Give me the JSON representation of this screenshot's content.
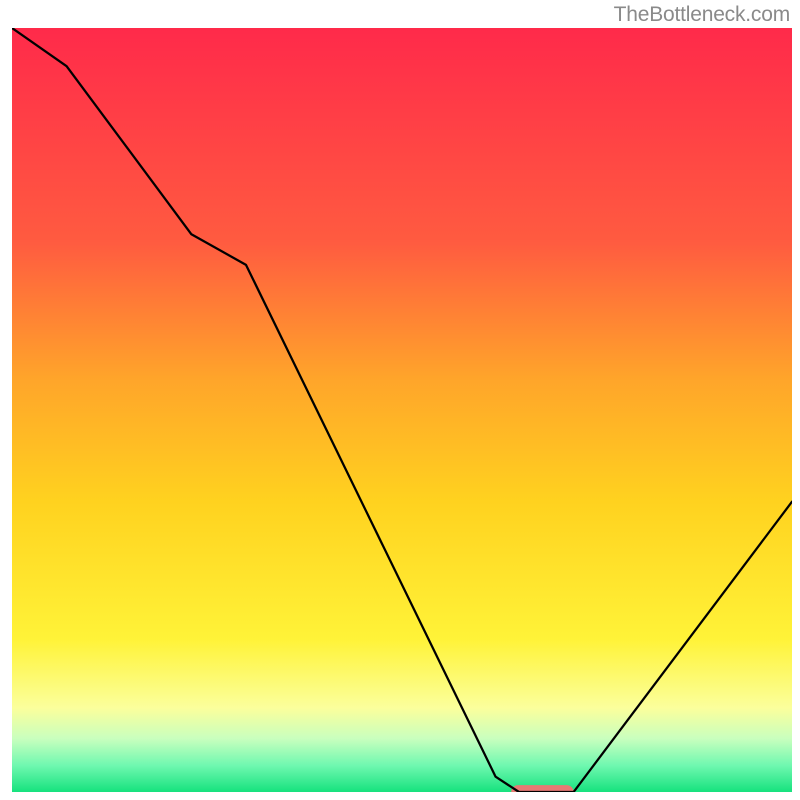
{
  "attribution": "TheBottleneck.com",
  "chart_data": {
    "type": "line",
    "title": "",
    "xlabel": "",
    "ylabel": "",
    "xlim": [
      0,
      100
    ],
    "ylim": [
      0,
      100
    ],
    "background": {
      "type": "linear-gradient",
      "angle_deg": 180,
      "stops": [
        {
          "offset": 0.0,
          "color": "#ff2a4a"
        },
        {
          "offset": 0.28,
          "color": "#ff5b40"
        },
        {
          "offset": 0.46,
          "color": "#ffa52a"
        },
        {
          "offset": 0.62,
          "color": "#ffd21f"
        },
        {
          "offset": 0.8,
          "color": "#fff338"
        },
        {
          "offset": 0.89,
          "color": "#fbff9c"
        },
        {
          "offset": 0.93,
          "color": "#c9ffbe"
        },
        {
          "offset": 0.965,
          "color": "#70f8b0"
        },
        {
          "offset": 1.0,
          "color": "#16e27e"
        }
      ]
    },
    "series": [
      {
        "name": "bottleneck-curve",
        "x": [
          0,
          7,
          23,
          30,
          62,
          65,
          72,
          100
        ],
        "y": [
          100,
          95,
          73,
          69,
          2,
          0,
          0,
          38
        ]
      }
    ],
    "markers": [
      {
        "name": "sweet-spot",
        "shape": "rounded-rect",
        "color": "#e77a74",
        "x_range": [
          64,
          72
        ],
        "y": 0,
        "height_pct": 1.8
      }
    ],
    "axes_visible": false,
    "grid": false
  }
}
